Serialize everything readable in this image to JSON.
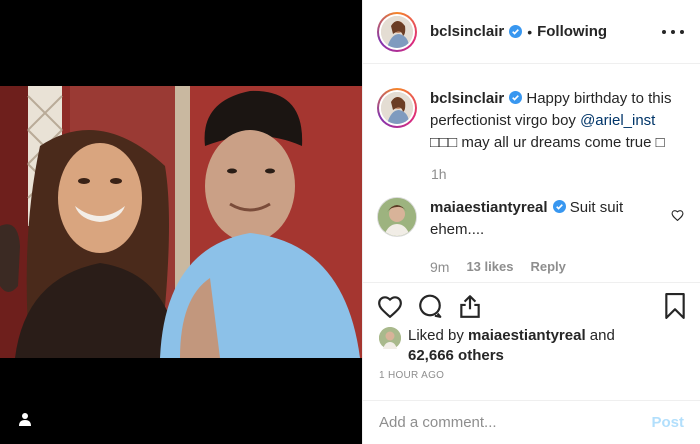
{
  "post": {
    "author": "bclsinclair",
    "follow_state": "Following",
    "separator": "•",
    "caption_prefix": "Happy birthday to this perfectionist virgo boy ",
    "caption_mention": "@ariel_inst",
    "caption_suffix": " □□□ may all ur dreams come true □",
    "caption_time": "1h"
  },
  "comment": {
    "user": "maiaestiantyreal",
    "text": "Suit suit ehem....",
    "time": "9m",
    "likes": "13 likes",
    "reply_label": "Reply"
  },
  "likes": {
    "prefix": "Liked by ",
    "user": "maiaestiantyreal",
    "middle": " and",
    "count": "62,666 others"
  },
  "posted_ago": "1 hour ago",
  "composer": {
    "placeholder": "Add a comment...",
    "post_label": "Post"
  },
  "icons": {
    "verified": "verified-badge-icon",
    "more": "more-options-icon",
    "like": "heart-icon",
    "comment": "speech-bubble-icon",
    "share": "share-icon",
    "save": "bookmark-icon",
    "tag": "user-tag-icon"
  },
  "colors": {
    "verified": "#3897f0",
    "mention": "#003569",
    "muted": "#8e8e8e",
    "post_disabled": "#b2dffc"
  }
}
